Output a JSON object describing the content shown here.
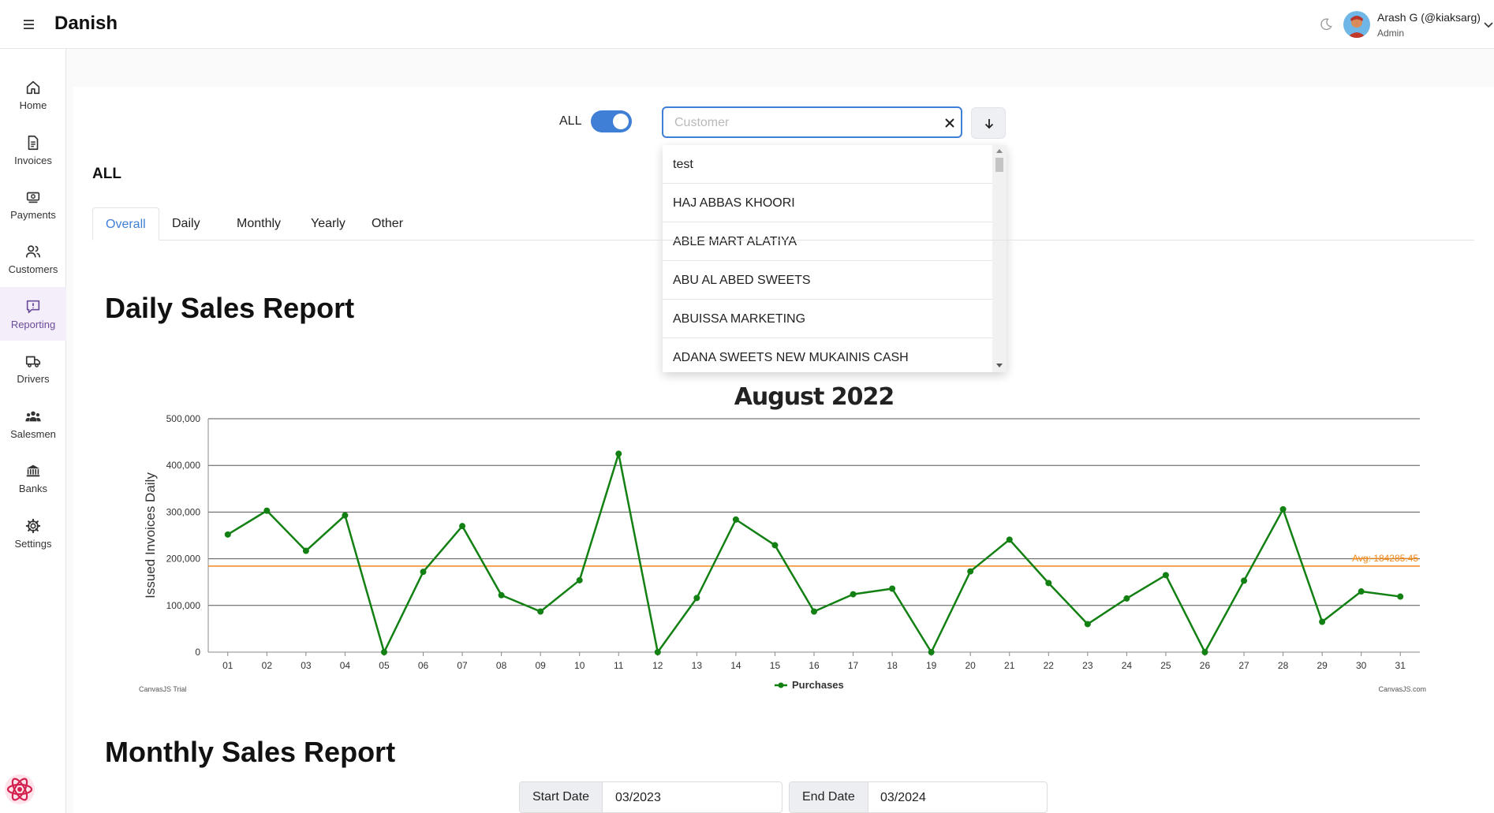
{
  "header": {
    "brand": "Danish",
    "user_name": "Arash G (@kiaksarg)",
    "user_role": "Admin"
  },
  "sidebar": {
    "items": [
      {
        "label": "Home",
        "icon": "home-icon"
      },
      {
        "label": "Invoices",
        "icon": "document-icon"
      },
      {
        "label": "Payments",
        "icon": "cash-icon"
      },
      {
        "label": "Customers",
        "icon": "users-icon"
      },
      {
        "label": "Reporting",
        "icon": "report-icon",
        "active": true
      },
      {
        "label": "Drivers",
        "icon": "truck-icon"
      },
      {
        "label": "Salesmen",
        "icon": "team-icon"
      },
      {
        "label": "Banks",
        "icon": "bank-icon"
      },
      {
        "label": "Settings",
        "icon": "gear-icon"
      }
    ]
  },
  "filter": {
    "toggle_label": "ALL",
    "toggle_on": true,
    "customer_placeholder": "Customer",
    "customer_value": ""
  },
  "dropdown": {
    "options": [
      "test",
      "HAJ ABBAS KHOORI",
      "ABLE MART ALATIYA",
      "ABU AL ABED SWEETS",
      "ABUISSA MARKETING",
      "ADANA SWEETS NEW MUKAINIS CASH"
    ]
  },
  "section_title": "ALL",
  "tabs": [
    "Overall",
    "Daily",
    "Monthly",
    "Yearly",
    "Other"
  ],
  "active_tab": "Overall",
  "daily_report": {
    "heading": "Daily Sales Report"
  },
  "monthly_report": {
    "heading": "Monthly Sales Report",
    "start_label": "Start Date",
    "start_value": "03/2023",
    "end_label": "End Date",
    "end_value": "03/2024"
  },
  "colors": {
    "accent": "#3f7fd6",
    "series": "#138013",
    "average": "#f08a1c"
  },
  "chart_data": {
    "type": "line",
    "title": "August 2022",
    "ylabel": "Issued Invoices Daily",
    "xlabel": "",
    "ylim": [
      0,
      500000
    ],
    "yticks": [
      "0",
      "100,000",
      "200,000",
      "300,000",
      "400,000",
      "500,000"
    ],
    "categories": [
      "01",
      "02",
      "03",
      "04",
      "05",
      "06",
      "07",
      "08",
      "09",
      "10",
      "11",
      "12",
      "13",
      "14",
      "15",
      "16",
      "17",
      "18",
      "19",
      "20",
      "21",
      "22",
      "23",
      "24",
      "25",
      "26",
      "27",
      "28",
      "29",
      "30",
      "31"
    ],
    "series": [
      {
        "name": "Purchases",
        "values": [
          252000,
          303000,
          217000,
          293000,
          0,
          172000,
          270000,
          122000,
          87000,
          154000,
          425000,
          0,
          116000,
          284000,
          229000,
          87000,
          124000,
          136000,
          0,
          173000,
          241000,
          148000,
          60000,
          115000,
          165000,
          0,
          153000,
          306000,
          65000,
          130000,
          119000
        ]
      }
    ],
    "average": {
      "value": 184285.45,
      "label": "Avg: 184285.45"
    },
    "legend": "bottom-center",
    "grid": true,
    "credit_left": "CanvasJS Trial",
    "credit_right": "CanvasJS.com"
  }
}
